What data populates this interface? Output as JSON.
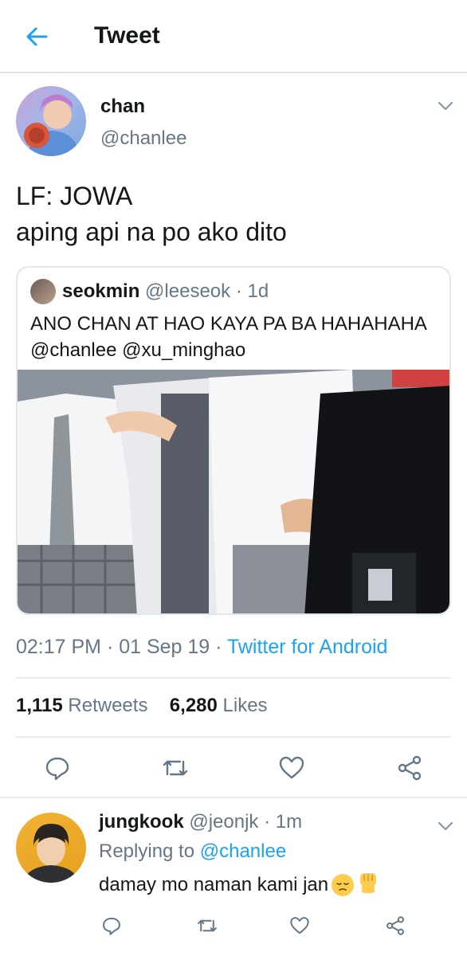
{
  "header": {
    "title": "Tweet",
    "back_icon": "arrow-left-icon"
  },
  "tweet": {
    "author_name": "chan",
    "author_handle": "@chanlee",
    "text_line1": "LF: JOWA",
    "text_line2": "aping api na po ako dito",
    "quote": {
      "name": "seokmin",
      "handle": "@leeseok",
      "time": "· 1d",
      "text": "ANO CHAN AT HAO KAYA PA BA HAHAHAHA @chanlee @xu_minghao"
    },
    "time": "02:17 PM · 01 Sep 19 · ",
    "source": "Twitter for Android",
    "retweets_count": "1,115",
    "retweets_label": "Retweets",
    "likes_count": "6,280",
    "likes_label": "Likes"
  },
  "reply": {
    "name": "jungkook",
    "handle": "@jeonjk",
    "time": "· 1m",
    "replying_label": "Replying to",
    "replying_to": "@chanlee",
    "text": "damay mo naman kami jan"
  },
  "colors": {
    "accent": "#1da1f2",
    "text": "#14171a",
    "muted": "#657786",
    "border": "#e1e8ed"
  }
}
